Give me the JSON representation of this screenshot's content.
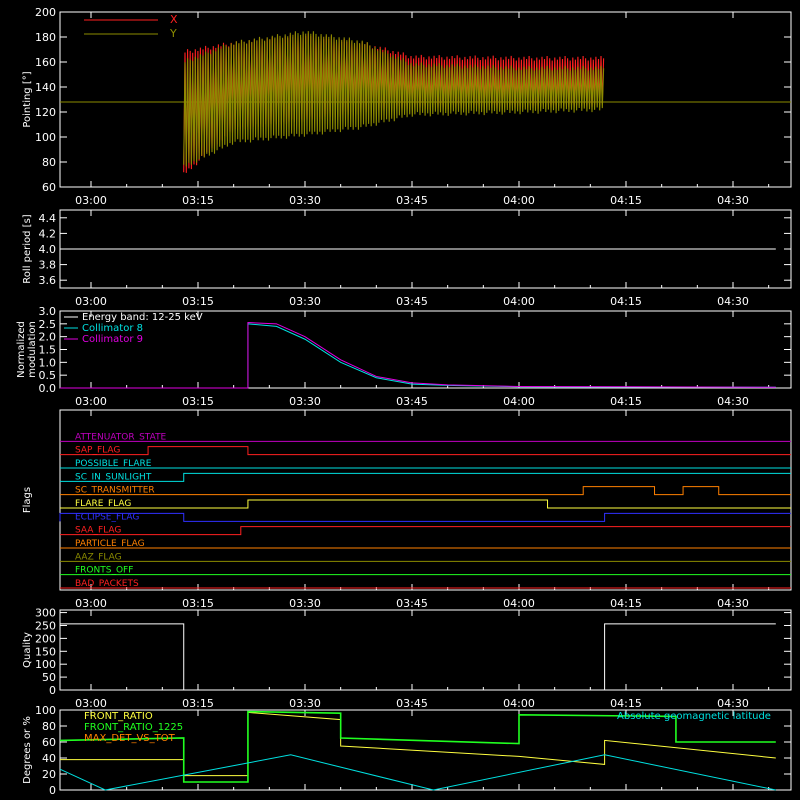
{
  "time_ticks": [
    "03:00",
    "03:15",
    "03:30",
    "03:45",
    "04:00",
    "04:15",
    "04:30"
  ],
  "colors": {
    "red": "#ff2020",
    "olive": "#8c8c00",
    "white": "#ffffff",
    "cyan": "#00e0e0",
    "magenta": "#e000e0",
    "yellow": "#ffff40",
    "green": "#20ff20",
    "orange": "#ff8000",
    "blue": "#3030ff",
    "purple": "#c000c0"
  },
  "chart_data": [
    {
      "id": "pointing",
      "type": "area",
      "ylabel": "Pointing [°]",
      "ylim": [
        60,
        200
      ],
      "yticks": [
        60,
        80,
        100,
        120,
        140,
        160,
        180,
        200
      ],
      "legend": [
        "X",
        "Y"
      ],
      "legend_placement": "top-left",
      "reference_line": 128,
      "data_range_time": [
        "03:13",
        "04:12"
      ],
      "series": [
        {
          "name": "X",
          "x": [
            "03:13",
            "03:20",
            "03:30",
            "03:38",
            "03:45",
            "04:00",
            "04:12"
          ],
          "max": [
            168,
            175,
            182,
            175,
            164,
            163,
            163
          ],
          "min": [
            70,
            106,
            114,
            120,
            124,
            124,
            126
          ]
        },
        {
          "name": "Y",
          "x": [
            "03:13",
            "03:20",
            "03:30",
            "03:38",
            "03:45",
            "04:00",
            "04:12"
          ],
          "max": [
            160,
            175,
            184,
            176,
            158,
            155,
            155
          ],
          "min": [
            76,
            96,
            102,
            108,
            118,
            120,
            122
          ]
        }
      ]
    },
    {
      "id": "roll",
      "type": "line",
      "ylabel": "Roll period [s]",
      "ylim": [
        3.5,
        4.5
      ],
      "yticks": [
        3.6,
        3.8,
        4.0,
        4.2,
        4.4
      ],
      "series": [
        {
          "x": [
            "02:54",
            "04:36"
          ],
          "y": [
            4.0,
            4.0
          ]
        }
      ]
    },
    {
      "id": "modulation",
      "type": "line",
      "ylabel": "Normalized modulation",
      "ylim": [
        0,
        3.0
      ],
      "yticks": [
        0.0,
        0.5,
        1.0,
        1.5,
        2.0,
        2.5,
        3.0
      ],
      "legend": [
        "Energy band: 12-25 keV",
        "Collimator 8",
        "Collimator 9"
      ],
      "series": [
        {
          "name": "Collimator 8",
          "x": [
            "02:54",
            "03:22",
            "03:22",
            "03:26",
            "03:30",
            "03:35",
            "03:40",
            "03:45",
            "03:50",
            "04:00",
            "04:36"
          ],
          "y": [
            0,
            0,
            2.5,
            2.4,
            1.9,
            1.0,
            0.4,
            0.15,
            0.1,
            0.05,
            0.03
          ]
        },
        {
          "name": "Collimator 9",
          "x": [
            "02:54",
            "03:22",
            "03:22",
            "03:26",
            "03:30",
            "03:35",
            "03:40",
            "03:45",
            "03:50",
            "04:00",
            "04:36"
          ],
          "y": [
            0,
            0,
            2.55,
            2.5,
            2.0,
            1.1,
            0.45,
            0.2,
            0.12,
            0.06,
            0.03
          ]
        }
      ]
    },
    {
      "id": "flags",
      "type": "line",
      "ylabel": "Flags",
      "series": [
        {
          "name": "ATTENUATOR_STATE",
          "color": "purple",
          "transitions": []
        },
        {
          "name": "SAP_FLAG",
          "color": "red",
          "transitions": [
            [
              "03:08",
              1
            ],
            [
              "03:22",
              0
            ]
          ]
        },
        {
          "name": "POSSIBLE_FLARE",
          "color": "cyan",
          "transitions": []
        },
        {
          "name": "SC_IN_SUNLIGHT",
          "color": "cyan",
          "transitions": [
            [
              "03:13",
              1
            ]
          ]
        },
        {
          "name": "SC_TRANSMITTER",
          "color": "orange",
          "transitions": [
            [
              "04:09",
              1
            ],
            [
              "04:19",
              0
            ],
            [
              "04:23",
              1
            ],
            [
              "04:28",
              0
            ]
          ]
        },
        {
          "name": "FLARE_FLAG",
          "color": "yellow",
          "transitions": [
            [
              "03:22",
              1
            ],
            [
              "04:04",
              0
            ]
          ]
        },
        {
          "name": "ECLIPSE_FLAG",
          "color": "blue",
          "transitions": [
            [
              "02:54",
              1
            ],
            [
              "03:13",
              0
            ],
            [
              "04:12",
              1
            ]
          ]
        },
        {
          "name": "SAA_FLAG",
          "color": "red",
          "transitions": [
            [
              "03:21",
              1
            ]
          ]
        },
        {
          "name": "PARTICLE_FLAG",
          "color": "orange",
          "transitions": []
        },
        {
          "name": "AAZ_FLAG",
          "color": "olive",
          "transitions": []
        },
        {
          "name": "FRONTS_OFF",
          "color": "green",
          "transitions": []
        },
        {
          "name": "BAD_PACKETS",
          "color": "red",
          "transitions": []
        }
      ]
    },
    {
      "id": "quality",
      "type": "line",
      "ylabel": "Quality",
      "ylim": [
        0,
        310
      ],
      "yticks": [
        0,
        50,
        100,
        150,
        200,
        250,
        300
      ],
      "series": [
        {
          "x": [
            "02:54",
            "03:13",
            "03:13",
            "04:12",
            "04:12",
            "04:36"
          ],
          "y": [
            256,
            256,
            0,
            0,
            256,
            256
          ]
        }
      ]
    },
    {
      "id": "ratios",
      "type": "line",
      "ylabel": "Degrees or %",
      "ylim": [
        0,
        100
      ],
      "yticks": [
        0,
        20,
        40,
        60,
        80,
        100
      ],
      "legend": [
        "FRONT_RATIO",
        "FRONT_RATIO_1225",
        "MAX_DET_VS_TOT",
        "Absolute geomagnetic latitude"
      ],
      "series": [
        {
          "name": "FRONT_RATIO",
          "color": "yellow",
          "x": [
            "02:54",
            "03:13",
            "03:13",
            "03:22",
            "03:22",
            "03:35",
            "03:35",
            "04:00",
            "04:12",
            "04:12",
            "04:36"
          ],
          "y": [
            38,
            38,
            18,
            18,
            97,
            88,
            55,
            42,
            32,
            62,
            40
          ]
        },
        {
          "name": "FRONT_RATIO_1225",
          "color": "green",
          "x": [
            "02:54",
            "03:13",
            "03:13",
            "03:22",
            "03:22",
            "03:35",
            "03:35",
            "04:00",
            "04:00",
            "04:22",
            "04:22",
            "04:36"
          ],
          "y": [
            62,
            65,
            10,
            10,
            98,
            96,
            65,
            58,
            94,
            92,
            60,
            60
          ]
        },
        {
          "name": "Absolute geomagnetic latitude",
          "color": "cyan",
          "x": [
            "02:54",
            "03:02",
            "03:28",
            "03:48",
            "04:12",
            "04:36"
          ],
          "y": [
            26,
            0,
            44,
            0,
            44,
            0
          ]
        }
      ]
    }
  ]
}
